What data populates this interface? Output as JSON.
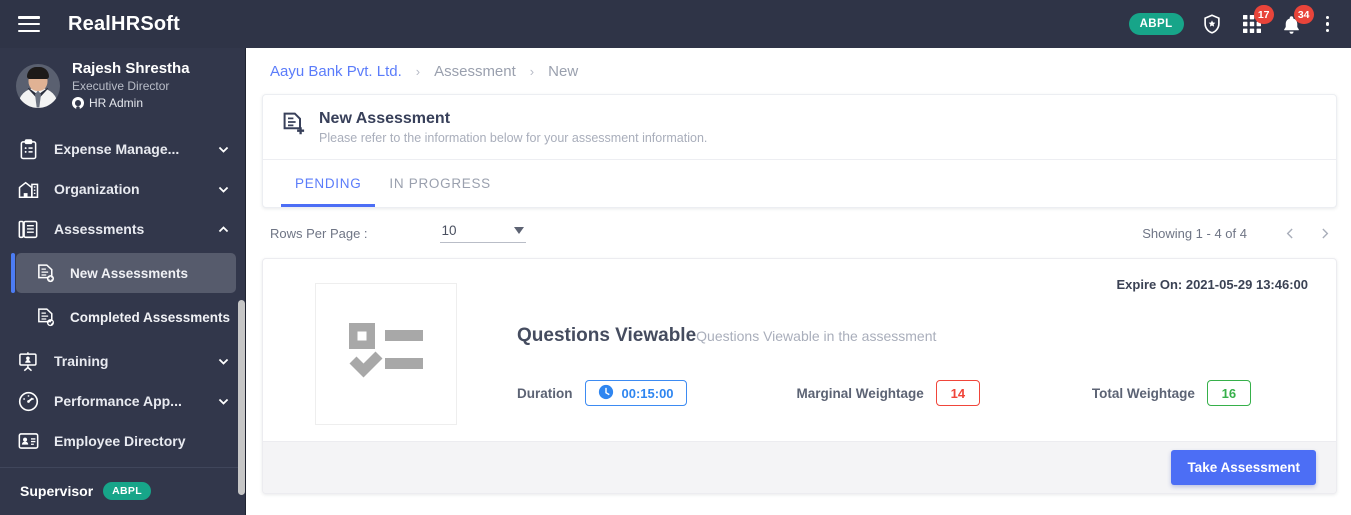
{
  "topbar": {
    "brand": "RealHRSoft",
    "menu_icon": "hamburger-icon",
    "org_badge": "ABPL",
    "shield_icon": "shield-star-icon",
    "apps_icon": "apps-grid-icon",
    "apps_badge": "17",
    "bell_icon": "bell-icon",
    "bell_badge": "34",
    "overflow_icon": "more-vertical-icon"
  },
  "sidebar": {
    "profile": {
      "name": "Rajesh Shrestha",
      "role": "Executive Director",
      "tag": "HR Admin"
    },
    "items": [
      {
        "label": "Expense Manage...",
        "icon": "clipboard-icon",
        "expandable": true,
        "expanded": false
      },
      {
        "label": "Organization",
        "icon": "building-icon",
        "expandable": true,
        "expanded": false
      },
      {
        "label": "Assessments",
        "icon": "documents-icon",
        "expandable": true,
        "expanded": true
      },
      {
        "label": "Training",
        "icon": "presentation-icon",
        "expandable": true,
        "expanded": false
      },
      {
        "label": "Performance App...",
        "icon": "gauge-icon",
        "expandable": true,
        "expanded": false
      },
      {
        "label": "Employee Directory",
        "icon": "id-card-icon",
        "expandable": false,
        "expanded": false
      }
    ],
    "sub_items": [
      {
        "label": "New Assessments",
        "icon": "document-plus-icon",
        "active": true
      },
      {
        "label": "Completed Assessments",
        "icon": "document-check-icon",
        "active": false
      }
    ],
    "footer": {
      "label": "Supervisor",
      "badge": "ABPL"
    }
  },
  "breadcrumb": {
    "root": "Aayu Bank Pvt. Ltd.",
    "middle": "Assessment",
    "current": "New",
    "separator": "›"
  },
  "panel": {
    "icon": "assessment-new-icon",
    "title": "New Assessment",
    "subtitle": "Please refer to the information below for your assessment information.",
    "tabs": [
      {
        "label": "PENDING",
        "active": true
      },
      {
        "label": "IN PROGRESS",
        "active": false
      }
    ]
  },
  "toolbar": {
    "rows_label": "Rows Per Page :",
    "rows_value": "10",
    "showing": "Showing 1 - 4 of 4",
    "prev_icon": "chevron-left-icon",
    "next_icon": "chevron-right-icon"
  },
  "assessment": {
    "thumbnail_icon": "checklist-placeholder-icon",
    "expire": "Expire On: 2021-05-29 13:46:00",
    "title": "Questions Viewable",
    "subtitle": "Questions Viewable in the assessment",
    "duration_label": "Duration",
    "duration_value": "00:15:00",
    "duration_icon": "clock-icon",
    "marginal_label": "Marginal Weightage",
    "marginal_value": "14",
    "total_label": "Total Weightage",
    "total_value": "16",
    "action_label": "Take Assessment"
  },
  "colors": {
    "topbar": "#2f3447",
    "sidebar": "#32374b",
    "accent": "#4c6ef5",
    "link": "#5b7cfa",
    "teal": "#17a589",
    "badge_red": "#e8443a",
    "chip_blue": "#2f86f0",
    "chip_red": "#f0453a",
    "chip_green": "#36b04a"
  }
}
